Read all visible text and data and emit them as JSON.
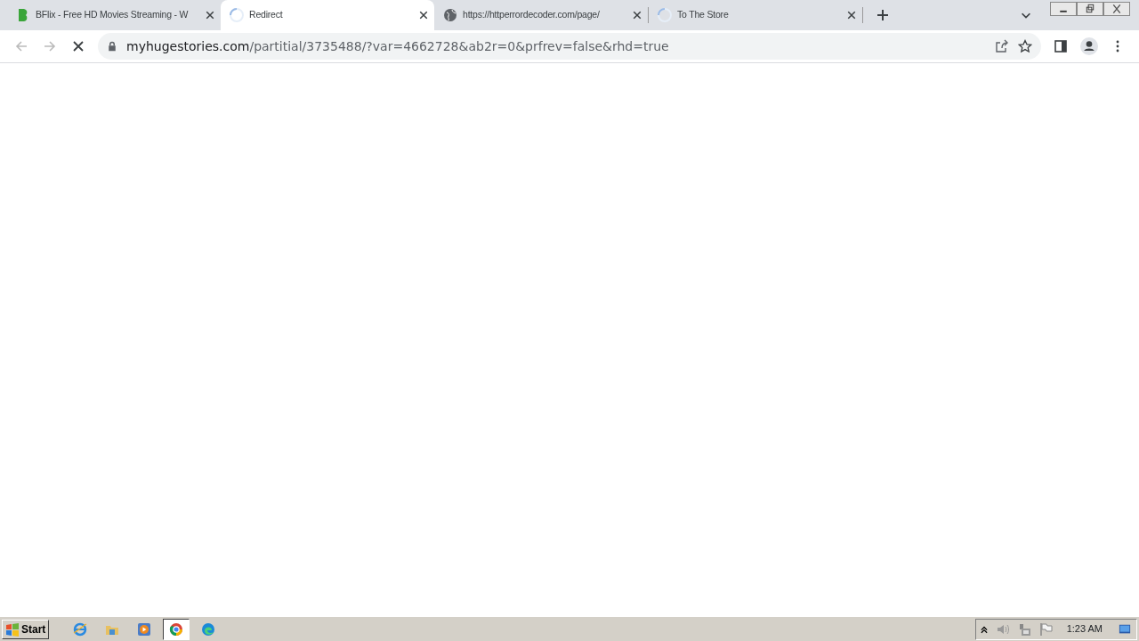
{
  "tabs": [
    {
      "kind": "logo",
      "title": "BFlix - Free HD Movies Streaming - W",
      "selected": false
    },
    {
      "kind": "spinner",
      "title": "Redirect",
      "selected": true
    },
    {
      "kind": "globe",
      "title": "https://httperrordecoder.com/page/",
      "selected": false
    },
    {
      "kind": "spinner",
      "title": "To The Store",
      "selected": false
    }
  ],
  "address": {
    "host": "myhugestories.com",
    "path": "/partitial/3735488/?var=4662728&ab2r=0&prfrev=false&rhd=true"
  },
  "taskbar": {
    "start": "Start",
    "apps": [
      {
        "kind": "ie",
        "selected": false
      },
      {
        "kind": "folder",
        "selected": false
      },
      {
        "kind": "media",
        "selected": false
      },
      {
        "kind": "chrome",
        "selected": true
      },
      {
        "kind": "edge",
        "selected": false
      }
    ],
    "clock": "1:23 AM"
  }
}
